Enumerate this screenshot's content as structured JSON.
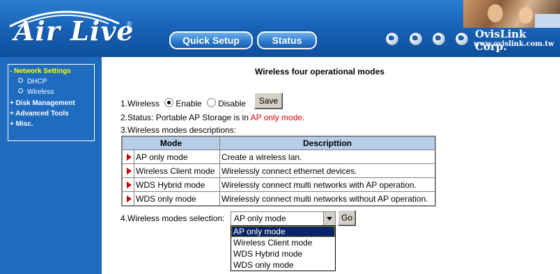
{
  "header": {
    "logo": "Air Live",
    "logo_reg": "®",
    "nav_buttons": [
      "Quick Setup",
      "Status"
    ],
    "globe_icons": [
      "globe-icon",
      "globe-icon",
      "globe-icon",
      "globe-icon"
    ],
    "company": "OvisLink Corp.",
    "company_url": "www.ovislink.com.tw"
  },
  "sidebar": {
    "items": [
      {
        "label": "- Network Settings",
        "active": true
      },
      {
        "label": "DHCP",
        "sub": true
      },
      {
        "label": "Wireless",
        "sub": true
      },
      {
        "label": "+ Disk Management"
      },
      {
        "label": "+ Advanced Tools"
      },
      {
        "label": "+ Misc."
      }
    ]
  },
  "main": {
    "title": "Wireless four operational modes",
    "wireless_label": "1.Wireless",
    "enable_label": "Enable",
    "disable_label": "Disable",
    "wireless_state": "Enable",
    "save_label": "Save",
    "status_prefix": "2.Status: Portable AP Storage is in ",
    "status_value": "AP only mode.",
    "desc_label": "3.Wireless modes descriptions:",
    "table": {
      "headers": [
        "Mode",
        "Descripttion"
      ],
      "rows": [
        {
          "mode": "AP only mode",
          "desc": "Create a wireless lan."
        },
        {
          "mode": "Wireless Client mode",
          "desc": "Wirelessly connect ethernet devices."
        },
        {
          "mode": "WDS Hybrid mode",
          "desc": "Wirelessly connect multi networks with AP operation."
        },
        {
          "mode": "WDS only mode",
          "desc": "Wirelessly connect multi networks without AP operation."
        }
      ]
    },
    "selection_label": "4.Wireless modes selection:",
    "selected_mode": "AP only mode",
    "go_label": "Go",
    "options": [
      "AP only mode",
      "Wireless Client mode",
      "WDS Hybrid mode",
      "WDS only mode"
    ]
  },
  "colors": {
    "header_blue": "#1660b4",
    "sidebar_blue": "#1e6bbf",
    "active_yellow": "#ffff00",
    "status_red": "#e00000",
    "table_header": "#b8cee8",
    "option_highlight": "#0a246a"
  }
}
